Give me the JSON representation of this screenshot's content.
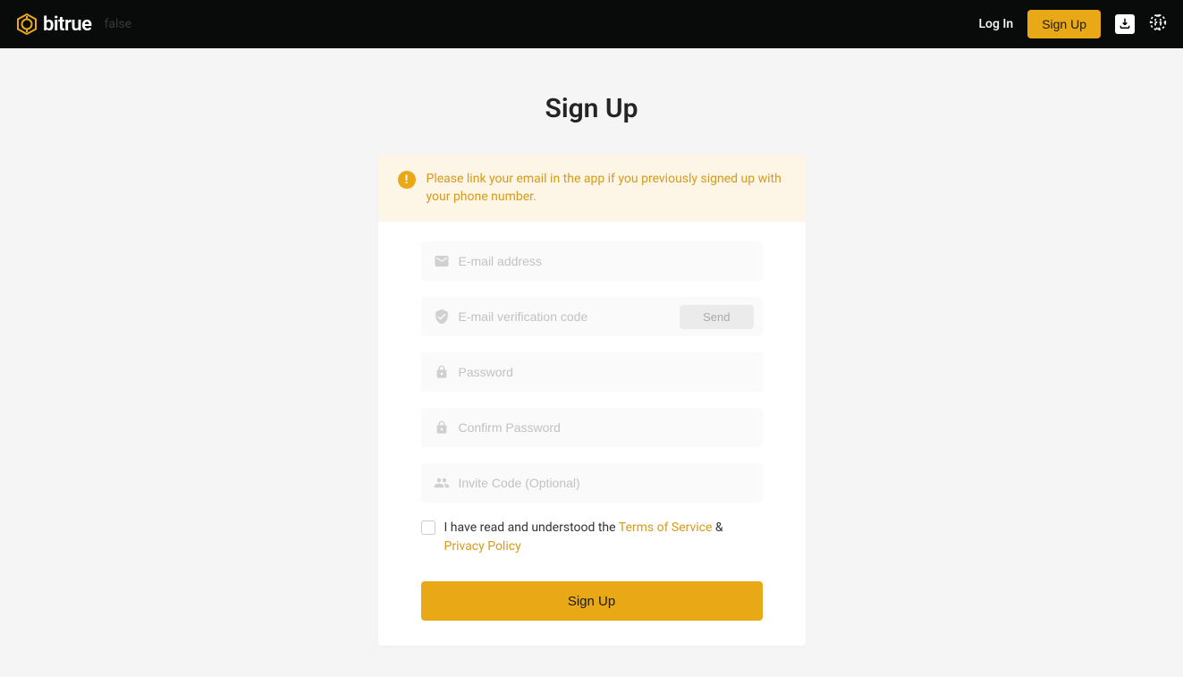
{
  "header": {
    "brand_name": "bitrue",
    "debug_text": "false",
    "login_label": "Log In",
    "signup_label": "Sign Up"
  },
  "page": {
    "title": "Sign Up"
  },
  "alert": {
    "message": "Please link your email in the app if you previously signed up with your phone number."
  },
  "form": {
    "email_placeholder": "E-mail address",
    "code_placeholder": "E-mail verification code",
    "send_label": "Send",
    "password_placeholder": "Password",
    "confirm_placeholder": "Confirm Password",
    "invite_placeholder": "Invite Code (Optional)",
    "agree_prefix": "I have read and understood the ",
    "terms_label": "Terms of Service",
    "ampersand": " & ",
    "privacy_label": "Privacy Policy",
    "submit_label": "Sign Up"
  }
}
